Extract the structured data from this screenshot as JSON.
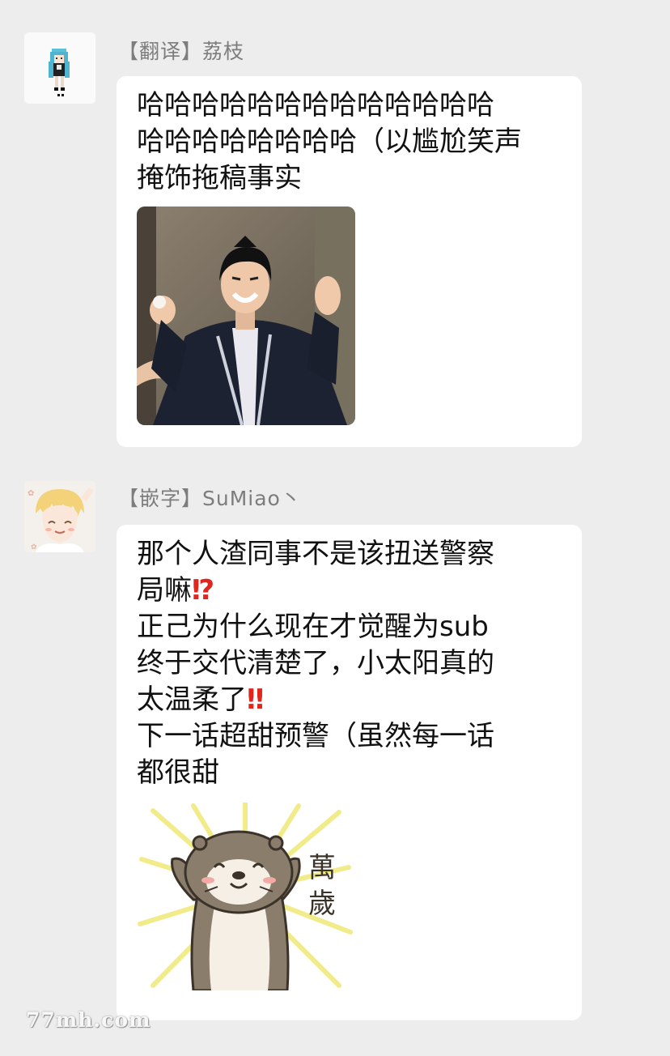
{
  "messages": [
    {
      "sender": "【翻译】荔枝",
      "avatar_icon": "pixel-character-icon",
      "lines": [
        "哈哈哈哈哈哈哈哈哈哈哈哈哈",
        "哈哈哈哈哈哈哈哈（以尴尬笑声",
        "掩饰拖稿事实"
      ],
      "image": "laughing-man-photo"
    },
    {
      "sender": "【嵌字】SuMiao丶",
      "avatar_icon": "anime-blonde-boy-icon",
      "lines": [
        {
          "text": "那个人渣同事不是该扭送警察",
          "emoji": ""
        },
        {
          "text": "局嘛",
          "emoji": "⁉"
        },
        {
          "text": "正己为什么现在才觉醒为sub",
          "emoji": ""
        },
        {
          "text": "终于交代清楚了，小太阳真的",
          "emoji": ""
        },
        {
          "text": "太温柔了",
          "emoji": "‼"
        },
        {
          "text": "下一话超甜预警（虽然每一话",
          "emoji": ""
        },
        {
          "text": "都很甜",
          "emoji": ""
        }
      ],
      "sticker": {
        "name": "otter-banzai-sticker",
        "text_1": "萬",
        "text_2": "歲"
      }
    }
  ],
  "watermark": "77mh.com",
  "colors": {
    "background": "#ededed",
    "bubble": "#ffffff",
    "sender": "#7d7d7d",
    "emoji_red": "#e0261d",
    "otter": "#8a7d6c",
    "sticker_rays": "#f1eb8a"
  }
}
